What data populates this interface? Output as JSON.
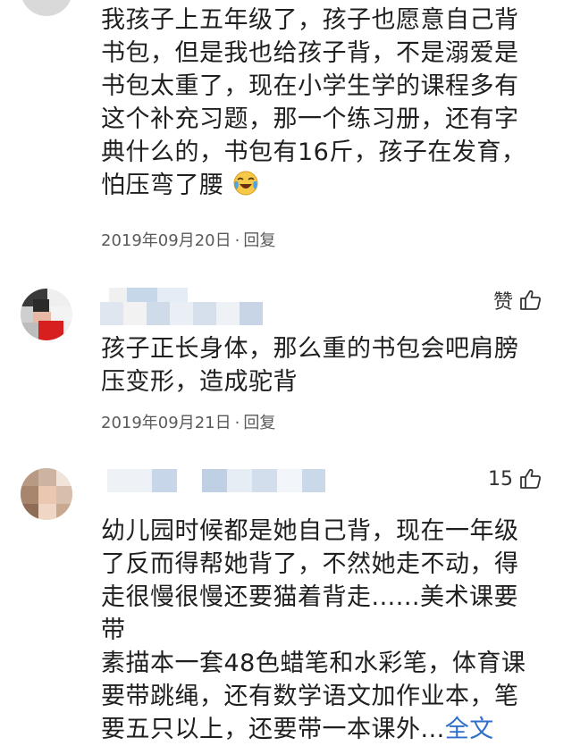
{
  "comments": [
    {
      "text_lines": [
        "我孩子上五年级了，孩子也愿意自己背",
        "书包，但是我也给孩子背，不是溺爱是",
        "书包太重了，现在小学生学的课程多有",
        "这个补充习题，那一个练习册，还有字",
        "典什么的，书包有16斤，孩子在发育，",
        "怕压弯了腰"
      ],
      "emoji": "crying-laughing-emoji",
      "date": "2019年09月20日",
      "separator": "·",
      "reply_label": "回复"
    },
    {
      "like_label": "赞",
      "text_lines": [
        "孩子正长身体，那么重的书包会吧肩膀",
        "压变形，造成驼背"
      ],
      "date": "2019年09月21日",
      "separator": "·",
      "reply_label": "回复"
    },
    {
      "like_count": "15",
      "text_lines": [
        "幼儿园时候都是她自己背，现在一年级",
        "了反而得帮她背了，不然她走不动，得",
        "走很慢很慢还要猫着背走......美术课要带",
        "素描本一套48色蜡笔和水彩笔，体育课",
        "要带跳绳，还有数学语文加作业本，笔",
        "要五只以上，还要带一本课外..."
      ],
      "full_text_link": "全文"
    }
  ],
  "colors": {
    "text": "#1f1f1f",
    "meta": "#5a5a5a",
    "link": "#2f6fc9"
  },
  "icons": [
    "thumbs-up-icon",
    "crying-laughing-emoji",
    "avatar"
  ]
}
